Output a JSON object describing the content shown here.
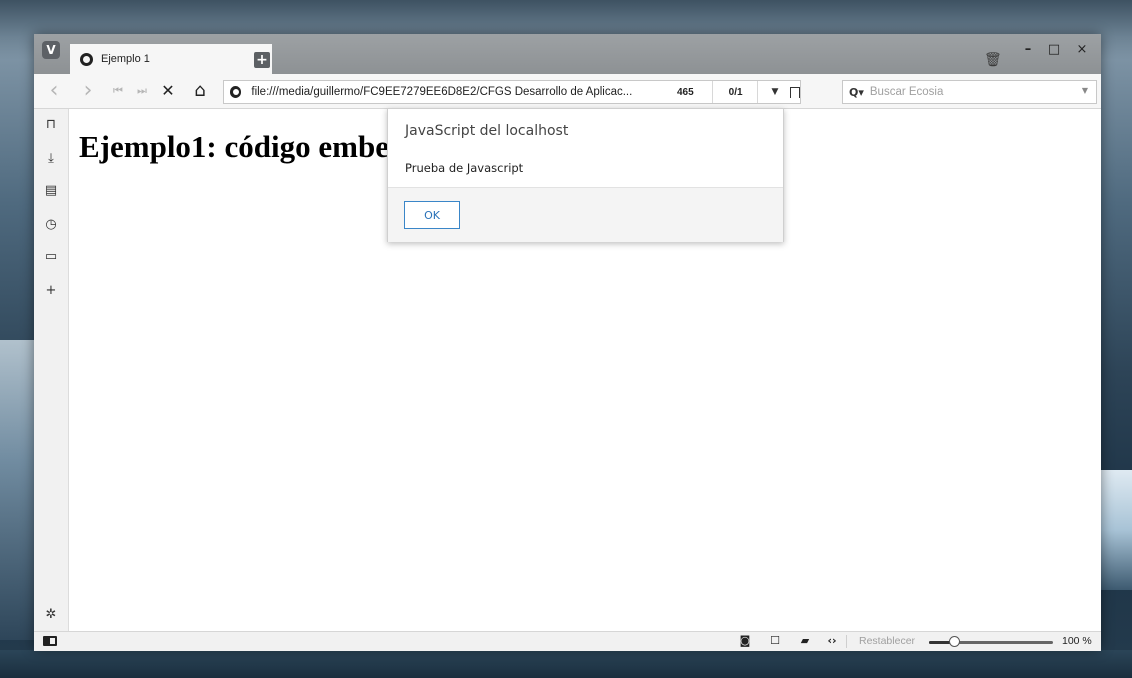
{
  "browser": {
    "logo_letter": "V",
    "tab": {
      "title": "Ejemplo 1"
    },
    "new_tab_label": "+",
    "window_controls": {
      "minimize": "–",
      "maximize": "□",
      "close": "×"
    }
  },
  "toolbar": {
    "back_icon": "‹",
    "forward_icon": "›",
    "rewind_icon": "⏮",
    "fastforward_icon": "⏭",
    "stop_icon": "✕",
    "home_icon": "⌂",
    "url": "file:///media/guillermo/FC9EE7279EE6D8E2/CFGS Desarrollo de Aplicac...",
    "count": "465",
    "pager": "0/1",
    "search_placeholder": "Buscar Ecosia"
  },
  "sidebar": {
    "items": [
      {
        "name": "bookmarks-icon",
        "glyph": "⊓"
      },
      {
        "name": "downloads-icon",
        "glyph": "⤓"
      },
      {
        "name": "notes-icon",
        "glyph": "▤"
      },
      {
        "name": "history-icon",
        "glyph": "◷"
      },
      {
        "name": "window-icon",
        "glyph": "▭"
      },
      {
        "name": "add-panel-icon",
        "glyph": "+"
      }
    ],
    "settings_glyph": "✲"
  },
  "page": {
    "heading": "Ejemplo1: código embe"
  },
  "dialog": {
    "title": "JavaScript del localhost",
    "message": "Prueba de Javascript",
    "ok_label": "OK"
  },
  "statusbar": {
    "reset_label": "Restablecer",
    "zoom_label": "100 %",
    "zoom_fraction": 0.2
  }
}
